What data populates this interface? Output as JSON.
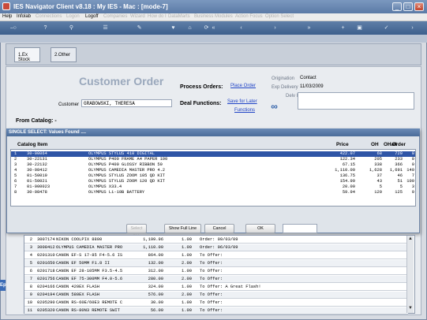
{
  "window": {
    "title": "IES Navigator Client v8.18 : My IES - Mac :     [mode-7]",
    "controls": [
      "_",
      "□",
      "×"
    ]
  },
  "menu": [
    {
      "label": "Help",
      "dim": false
    },
    {
      "label": "Infolab",
      "dim": false
    },
    {
      "label": "Connections",
      "dim": true
    },
    {
      "label": "Logon",
      "dim": true
    },
    {
      "label": "Logoff",
      "dim": false
    },
    {
      "label": "Companies",
      "dim": true
    },
    {
      "label": "Wizard",
      "dim": true
    },
    {
      "label": "How do I",
      "dim": true
    },
    {
      "label": "DataMarts",
      "dim": true
    },
    {
      "label": "Business Modules",
      "dim": true
    },
    {
      "label": "Action Focus",
      "dim": true
    },
    {
      "label": "Option Select",
      "dim": true
    }
  ],
  "toolbar_icons": [
    "key-icon",
    "help-icon",
    "search-icon",
    "list-icon",
    "edit-icon",
    "favorite-icon",
    "home-icon",
    "refresh-icon",
    "back-icon",
    "back-icon",
    "forward-icon",
    "forward-icon",
    "add-icon",
    "save-icon",
    "confirm-icon",
    "next-icon"
  ],
  "tabs": [
    {
      "label": "1.Ex Stock"
    },
    {
      "label": "2.Other"
    }
  ],
  "order": {
    "heading": "Customer Order",
    "customer_label": "Customer",
    "customer_value": "GRABOWSKI, THERESA",
    "process_orders_label": "Process Orders:",
    "place_order_link": "Place Order",
    "deal_functions_label": "Deal Functions:",
    "save_for_later_link": "Save for Later",
    "functions_link": "Functions",
    "origination_label": "Origination",
    "origination_value": "Contact",
    "exp_delivery_label": "Exp Delivery",
    "exp_delivery_value": "11/03/2009",
    "delv_instr_label": "Delv Instr",
    "from_catalog_label": "From Catalog: -"
  },
  "dialog": {
    "title": "SINGLE SELECT: Values Found ....",
    "headers": {
      "catalog_item": "Catalog Item",
      "price": "Price",
      "oh": "OH",
      "ohall": "OHall",
      "order": "Order"
    },
    "rows": [
      {
        "n": "1",
        "code": "30-00064",
        "desc": "OLYMPUS STYLUS 410 DIGITAL",
        "price": "422.07",
        "oh": "68",
        "ohall": "729",
        "order": "0",
        "selected": true
      },
      {
        "n": "2",
        "code": "30-22131",
        "desc": "OLYMPUS P400 FRAME A4 PAPER 100",
        "price": "122.34",
        "oh": "205",
        "ohall": "233",
        "order": "0",
        "selected": false
      },
      {
        "n": "3",
        "code": "30-22132",
        "desc": "OLYMPUS P400 GLOSSY RIBBON 50",
        "price": "67.15",
        "oh": "338",
        "ohall": "366",
        "order": "0",
        "selected": false
      },
      {
        "n": "4",
        "code": "30-08412",
        "desc": "OLYMPUS CAMEDIA MASTER PRO 4.2",
        "price": "1,110.00",
        "oh": "1,628",
        "ohall": "1,691",
        "order": "140",
        "selected": false
      },
      {
        "n": "5",
        "code": "01-50019",
        "desc": "OLYMPUS STYLUS ZOOM 105 QD KIT",
        "price": "136.75",
        "oh": "37",
        "ohall": "46",
        "order": "7",
        "selected": false
      },
      {
        "n": "6",
        "code": "01-50021",
        "desc": "OLYMPUS STYLUS ZOOM 120 QD KIT",
        "price": "154.99",
        "oh": "43",
        "ohall": "51",
        "order": "100",
        "selected": false
      },
      {
        "n": "7",
        "code": "01-000023",
        "desc": "OLYMPUS X33.4",
        "price": "20.00",
        "oh": "5",
        "ohall": "5",
        "order": "3",
        "selected": false
      },
      {
        "n": "8",
        "code": "30-08478",
        "desc": "OLYMPUS Li-10B BATTERY",
        "price": "59.94",
        "oh": "120",
        "ohall": "125",
        "order": "0",
        "selected": false
      }
    ],
    "buttons": {
      "select_all": "Select ALL",
      "show_full_line": "Show Full Line",
      "cancel": "Cancel",
      "ok": "OK"
    }
  },
  "grid": {
    "rows": [
      {
        "n": "2",
        "code": "3007174",
        "desc": "NIKON COOLPIX 8800",
        "price": "1,199.96",
        "qty": "1.00",
        "note": "Order: 09/03/09"
      },
      {
        "n": "3",
        "code": "3008412",
        "desc": "OLYMPUS CAMEDIA MASTER PRO",
        "price": "1,110.00",
        "qty": "1.00",
        "note": "Order: 06/03/09"
      },
      {
        "n": "4",
        "code": "0201310",
        "desc": "CANON EF-S 17-85 F4-5.6 IS",
        "price": "864.00",
        "qty": "1.00",
        "note": "To Offer:"
      },
      {
        "n": "5",
        "code": "0201650",
        "desc": "CANON EF 50MM F1.8 II",
        "price": "132.00",
        "qty": "2.00",
        "note": "To Offer:"
      },
      {
        "n": "6",
        "code": "0201718",
        "desc": "CANON EF 28-105MM F3.5-4.5",
        "price": "312.00",
        "qty": "1.00",
        "note": "To Offer:"
      },
      {
        "n": "7",
        "code": "0201756",
        "desc": "CANON EF 75-300MM F4.0-5.6",
        "price": "280.00",
        "qty": "2.00",
        "note": "To Offer:"
      },
      {
        "n": "8",
        "code": "0204166",
        "desc": "CANON 420EX FLASH",
        "price": "324.00",
        "qty": "1.00",
        "note": "To Offer: A Great Flash!"
      },
      {
        "n": "9",
        "code": "0204194",
        "desc": "CANON 580EX FLASH",
        "price": "576.00",
        "qty": "2.00",
        "note": "To Offer:"
      },
      {
        "n": "10",
        "code": "0205290",
        "desc": "CANON RS-60E/60E3 REMOTE C",
        "price": "30.00",
        "qty": "1.00",
        "note": "To Offer:"
      },
      {
        "n": "11",
        "code": "0205320",
        "desc": "CANON RS-80N3 REMOTE SWIT",
        "price": "56.00",
        "qty": "1.00",
        "note": "To Offer:"
      }
    ]
  },
  "sidebar_tag": "Ep"
}
